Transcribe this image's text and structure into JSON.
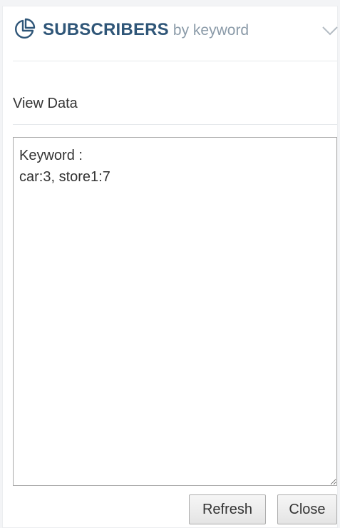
{
  "widget": {
    "title": "SUBSCRIBERS",
    "subtitle": "by keyword",
    "icon": "pie-chart-icon",
    "collapse_icon": "chevron-down-icon",
    "accent_color": "#2f5678",
    "subtitle_color": "#8a9aa8"
  },
  "section": {
    "label": "View Data"
  },
  "data_box": {
    "text": "Keyword :\ncar:3, store1:7"
  },
  "buttons": {
    "refresh_label": "Refresh",
    "close_label": "Close"
  }
}
